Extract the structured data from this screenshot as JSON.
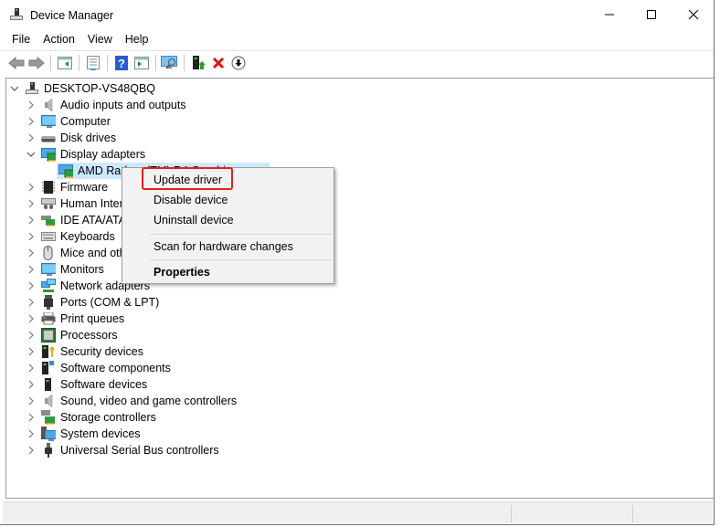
{
  "window": {
    "title": "Device Manager",
    "controls": {
      "minimize": "minimize",
      "maximize": "maximize",
      "close": "close"
    }
  },
  "menubar": [
    "File",
    "Action",
    "View",
    "Help"
  ],
  "toolbar": [
    {
      "name": "back-arrow-icon",
      "type": "button"
    },
    {
      "name": "forward-arrow-icon",
      "type": "button"
    },
    {
      "name": "show-hide-console-tree-icon",
      "type": "button"
    },
    {
      "name": "properties-icon",
      "type": "button"
    },
    {
      "name": "help-icon",
      "type": "button"
    },
    {
      "name": "show-hide-action-pane-icon",
      "type": "button"
    },
    {
      "name": "scan-hardware-icon",
      "type": "button"
    },
    {
      "name": "update-driver-icon",
      "type": "button"
    },
    {
      "name": "uninstall-device-icon",
      "type": "button"
    },
    {
      "name": "enable-device-icon",
      "type": "button"
    }
  ],
  "tree": {
    "root": "DESKTOP-VS48QBQ",
    "categories": [
      {
        "label": "Audio inputs and outputs",
        "icon": "speaker-icon",
        "expanded": false
      },
      {
        "label": "Computer",
        "icon": "computer-icon",
        "expanded": false
      },
      {
        "label": "Disk drives",
        "icon": "disk-drive-icon",
        "expanded": false
      },
      {
        "label": "Display adapters",
        "icon": "display-adapter-icon",
        "expanded": true,
        "children": [
          {
            "label": "AMD Radeon(TM) R4 Graphics",
            "icon": "display-adapter-icon",
            "selected": true
          }
        ]
      },
      {
        "label": "Firmware",
        "icon": "chip-icon",
        "expanded": false
      },
      {
        "label": "Human Interface Devices",
        "icon": "hid-icon",
        "expanded": false
      },
      {
        "label": "IDE ATA/ATAPI controllers",
        "icon": "ide-controller-icon",
        "expanded": false
      },
      {
        "label": "Keyboards",
        "icon": "keyboard-icon",
        "expanded": false
      },
      {
        "label": "Mice and other pointing devices",
        "icon": "mouse-icon",
        "expanded": false
      },
      {
        "label": "Monitors",
        "icon": "monitor-icon",
        "expanded": false
      },
      {
        "label": "Network adapters",
        "icon": "network-icon",
        "expanded": false
      },
      {
        "label": "Ports (COM & LPT)",
        "icon": "port-icon",
        "expanded": false
      },
      {
        "label": "Print queues",
        "icon": "printer-icon",
        "expanded": false
      },
      {
        "label": "Processors",
        "icon": "processor-icon",
        "expanded": false
      },
      {
        "label": "Security devices",
        "icon": "security-device-icon",
        "expanded": false
      },
      {
        "label": "Software components",
        "icon": "software-component-icon",
        "expanded": false
      },
      {
        "label": "Software devices",
        "icon": "software-device-icon",
        "expanded": false
      },
      {
        "label": "Sound, video and game controllers",
        "icon": "speaker-icon",
        "expanded": false
      },
      {
        "label": "Storage controllers",
        "icon": "storage-controller-icon",
        "expanded": false
      },
      {
        "label": "System devices",
        "icon": "system-device-icon",
        "expanded": false
      },
      {
        "label": "Universal Serial Bus controllers",
        "icon": "usb-icon",
        "expanded": false
      }
    ]
  },
  "context_menu": {
    "items": [
      "Update driver",
      "Disable device",
      "Uninstall device",
      "Scan for hardware changes",
      "Properties"
    ],
    "highlighted": "Update driver"
  },
  "colors": {
    "selection": "#cce8ff",
    "highlight_box": "#e61d1d",
    "menu_bg": "#f2f2f2"
  }
}
